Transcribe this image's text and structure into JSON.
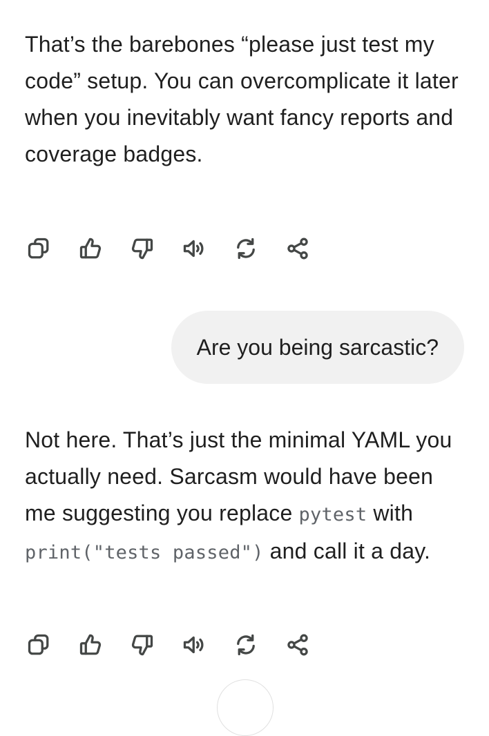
{
  "messages": [
    {
      "role": "assistant",
      "text": "That’s the barebones “please just test my code” setup. You can overcomplicate it later when you inevitably want fancy reports and coverage badges."
    },
    {
      "role": "user",
      "text": "Are you being sarcastic?"
    },
    {
      "role": "assistant",
      "text_1": "Not here. That’s just the minimal YAML you actually need. Sarcasm would have been me suggesting you replace ",
      "code_1": "pytest",
      "text_2": " with ",
      "code_2": "print(\"tests passed\")",
      "text_3": " and call it a day."
    }
  ],
  "action_icons": [
    "copy-icon",
    "thumbs-up-icon",
    "thumbs-down-icon",
    "read-aloud-icon",
    "regenerate-icon",
    "share-icon"
  ],
  "colors": {
    "user_bubble": "#f1f1f1",
    "text": "#1f1f1f",
    "icon": "#444746",
    "code_text": "#5f6368"
  }
}
